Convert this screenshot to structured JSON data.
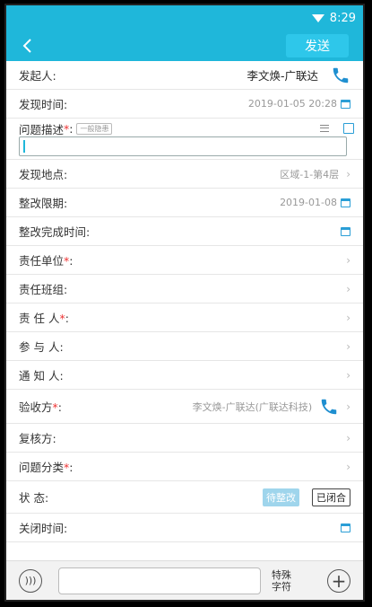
{
  "status_bar": {
    "time": "8:29"
  },
  "navbar": {
    "send_label": "发送"
  },
  "form": {
    "initiator": {
      "label": "发起人:",
      "value": "李文焕-广联达"
    },
    "found_time": {
      "label": "发现时间:",
      "value": "2019-01-05 20:28"
    },
    "description": {
      "label": "问题描述",
      "tag": "一般隐患",
      "value": ""
    },
    "location": {
      "label": "发现地点:",
      "value": "区域-1-第4层"
    },
    "deadline": {
      "label": "整改限期:",
      "value": "2019-01-08"
    },
    "completion_time": {
      "label": "整改完成时间:",
      "value": ""
    },
    "responsible_unit": {
      "label": "责任单位"
    },
    "responsible_team": {
      "label": "责任班组:"
    },
    "responsible_person": {
      "label": "责 任 人"
    },
    "participants": {
      "label": "参 与 人:"
    },
    "notify": {
      "label": "通 知 人:"
    },
    "acceptor": {
      "label": "验收方",
      "value": "李文焕-广联达(广联达科技)"
    },
    "reviewer": {
      "label": "复核方:"
    },
    "category": {
      "label": "问题分类"
    },
    "status": {
      "label": "状 态:",
      "pending": "待整改",
      "closed": "已闭合"
    },
    "close_time": {
      "label": "关闭时间:"
    }
  },
  "bottom_bar": {
    "special_chars": "特殊字符"
  },
  "colors": {
    "accent": "#1fb7da",
    "required": "#e33333",
    "icon": "#2a9ed6"
  }
}
